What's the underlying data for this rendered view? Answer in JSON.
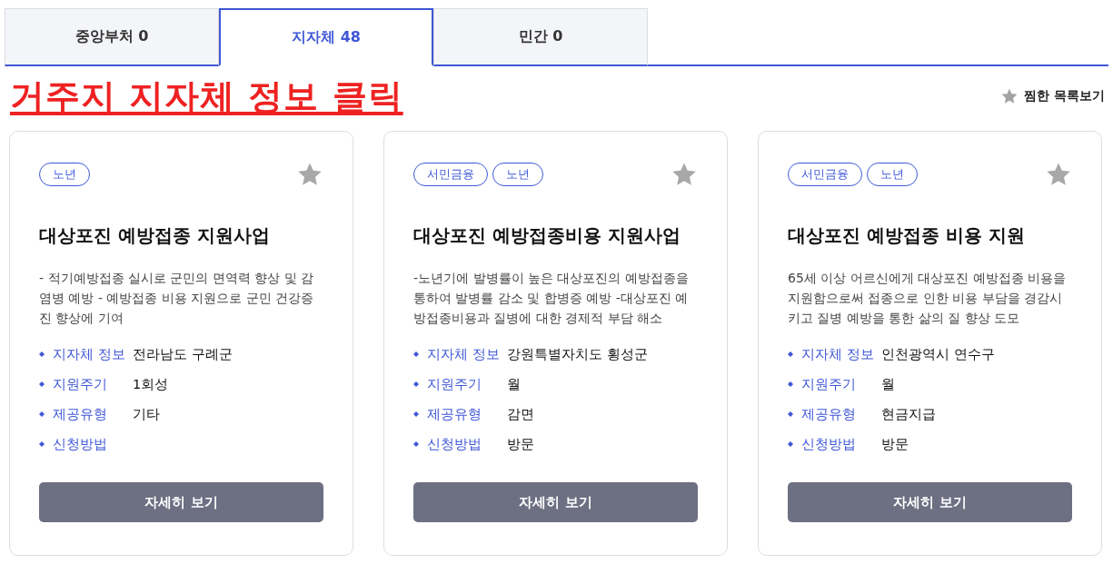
{
  "tabs": [
    {
      "label": "중앙부처 0",
      "selected": false
    },
    {
      "label": "지자체 48",
      "selected": true
    },
    {
      "label": "민간 0",
      "selected": false
    }
  ],
  "annotation": "거주지 지자체 정보 클릭",
  "favorites_link": "찜한 목록보기",
  "cards": [
    {
      "tags": [
        "노년"
      ],
      "starred": false,
      "title": "대상포진 예방접종 지원사업",
      "description": "- 적기예방접종 실시로 군민의 면역력 향상 및 감염병 예방 - 예방접종 비용 지원으로 군민 건강증진 향상에 기여",
      "fields": [
        {
          "label": "지자체 정보",
          "value": "전라남도 구례군"
        },
        {
          "label": "지원주기",
          "value": "1회성"
        },
        {
          "label": "제공유형",
          "value": "기타"
        },
        {
          "label": "신청방법"
        }
      ],
      "button": "자세히 보기"
    },
    {
      "tags": [
        "서민금융",
        "노년"
      ],
      "starred": false,
      "title": "대상포진 예방접종비용 지원사업",
      "description": "-노년기에 발병률이 높은 대상포진의 예방접종을 통하여 발병률 감소 및 합병증 예방 -대상포진 예방접종비용과 질병에 대한 경제적 부담 해소",
      "fields": [
        {
          "label": "지자체 정보",
          "value": "강원특별자치도 횡성군"
        },
        {
          "label": "지원주기",
          "value": "월"
        },
        {
          "label": "제공유형",
          "value": "감면"
        },
        {
          "label": "신청방법",
          "value": "방문"
        }
      ],
      "button": "자세히 보기"
    },
    {
      "tags": [
        "서민금융",
        "노년"
      ],
      "starred": false,
      "title": "대상포진 예방접종 비용 지원",
      "description": "65세 이상 어르신에게 대상포진 예방접종 비용을 지원함으로써 접종으로 인한 비용 부담을 경감시키고 질병 예방을 통한 삶의 질 향상 도모",
      "fields": [
        {
          "label": "지자체 정보",
          "value": "인천광역시 연수구"
        },
        {
          "label": "지원주기",
          "value": "월"
        },
        {
          "label": "제공유형",
          "value": "현금지급"
        },
        {
          "label": "신청방법",
          "value": "방문"
        }
      ],
      "button": "자세히 보기"
    }
  ]
}
